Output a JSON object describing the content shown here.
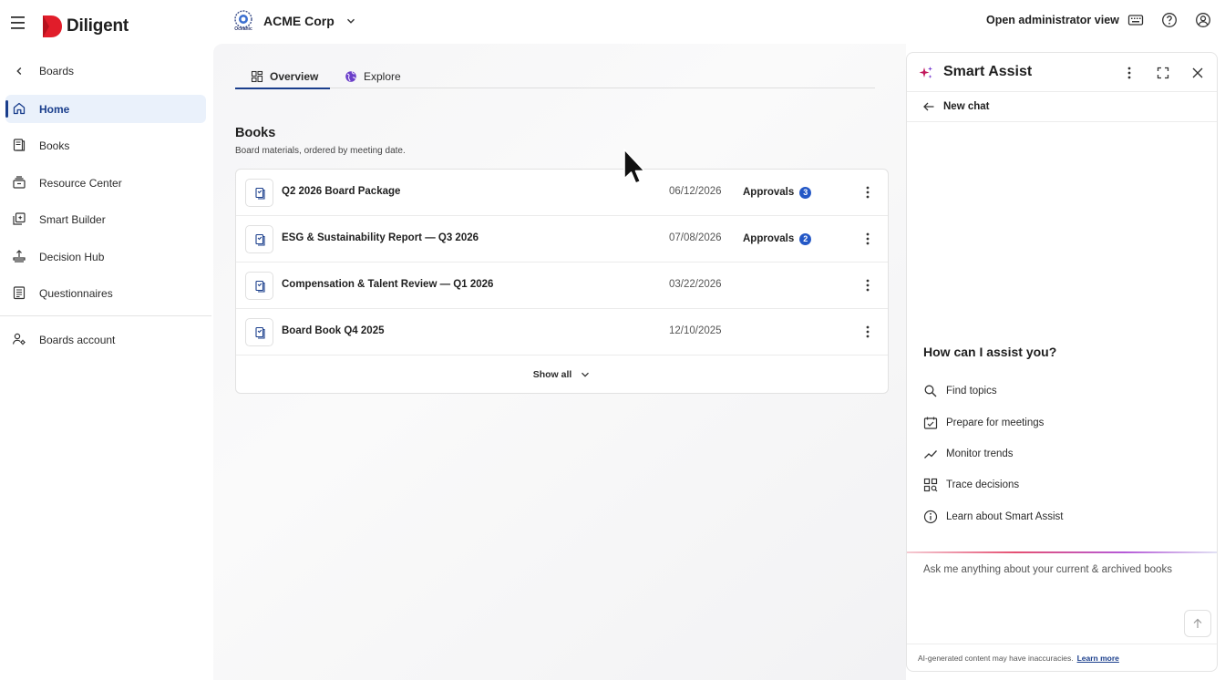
{
  "app": {
    "brand": "Diligent",
    "brand_color": "#e11d2a",
    "accent_color": "#1a3e8c",
    "org_name": "ACME Corp",
    "org_logo_text": "Oceanic",
    "admin_link": "Open administrator view"
  },
  "topbar_icons": [
    "keyboard-icon",
    "help-icon",
    "account-icon"
  ],
  "sidebar": {
    "back_label": "Boards",
    "items": [
      {
        "label": "Home",
        "icon": "home-icon",
        "active": true
      },
      {
        "label": "Books",
        "icon": "books-icon",
        "active": false
      },
      {
        "label": "Resource Center",
        "icon": "resource-center-icon",
        "active": false
      },
      {
        "label": "Smart Builder",
        "icon": "smart-builder-icon",
        "active": false
      },
      {
        "label": "Decision Hub",
        "icon": "decision-hub-icon",
        "active": false
      },
      {
        "label": "Questionnaires",
        "icon": "questionnaires-icon",
        "active": false
      }
    ],
    "account_item": {
      "label": "Boards account",
      "icon": "boards-account-icon"
    }
  },
  "main": {
    "tabs": [
      {
        "label": "Overview",
        "icon": "overview-grid-icon",
        "active": true
      },
      {
        "label": "Explore",
        "icon": "explore-globe-icon",
        "active": false
      }
    ],
    "books_section": {
      "title": "Books",
      "subtitle": "Board materials, ordered by meeting date.",
      "rows": [
        {
          "title": "Q2 2026 Board Package",
          "date": "06/12/2026",
          "approvals_label": "Approvals",
          "approvals_count": "3"
        },
        {
          "title": "ESG & Sustainability Report — Q3 2026",
          "date": "07/08/2026",
          "approvals_label": "Approvals",
          "approvals_count": "2"
        },
        {
          "title": "Compensation & Talent Review — Q1 2026",
          "date": "03/22/2026",
          "approvals_label": "",
          "approvals_count": ""
        },
        {
          "title": "Board Book Q4 2025",
          "date": "12/10/2025",
          "approvals_label": "",
          "approvals_count": ""
        }
      ],
      "show_all_label": "Show all"
    }
  },
  "assist": {
    "title": "Smart Assist",
    "new_chat_label": "New chat",
    "question": "How can I assist you?",
    "suggestions": [
      {
        "label": "Find topics",
        "icon": "search-icon"
      },
      {
        "label": "Prepare for meetings",
        "icon": "calendar-check-icon"
      },
      {
        "label": "Monitor trends",
        "icon": "trend-line-icon"
      },
      {
        "label": "Trace decisions",
        "icon": "trace-grid-icon"
      },
      {
        "label": "Learn about Smart Assist",
        "icon": "info-icon"
      }
    ],
    "input_placeholder": "Ask me anything about your current & archived books",
    "footer_text": "AI-generated content may have inaccuracies.",
    "footer_link": "Learn more"
  }
}
